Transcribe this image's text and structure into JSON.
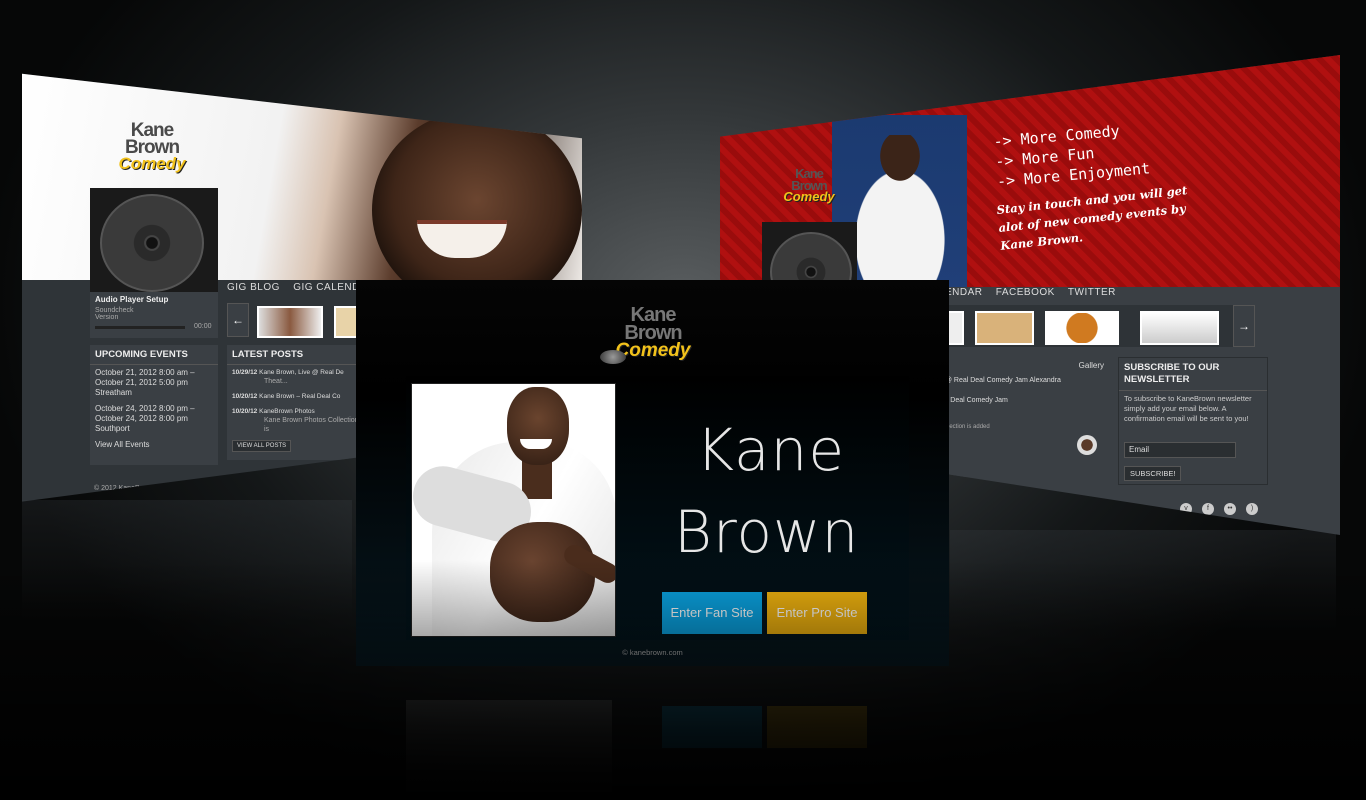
{
  "main": {
    "logo": {
      "line1": "Kane",
      "line2": "Brown",
      "line3": "Comedy"
    },
    "name_line1": "Kane",
    "name_line2": "Brown",
    "fan_button": "Enter Fan Site",
    "pro_button": "Enter Pro Site",
    "footer": "© kanebrown.com",
    "colors": {
      "fan": "#0aa4e3",
      "pro": "#f2b40f"
    }
  },
  "left_preview": {
    "nav": [
      "GIG BLOG",
      "GIG CALENDAR"
    ],
    "player": {
      "title": "Audio Player Setup",
      "track": "Soundcheck",
      "version": "Version",
      "time": "00:00"
    },
    "events_heading": "UPCOMING EVENTS",
    "events": [
      {
        "line1": "October 21, 2012 8:00 am –",
        "line2": "October 21, 2012 5:00 pm",
        "place": "Streatham"
      },
      {
        "line1": "October 24, 2012 8:00 pm –",
        "line2": "October 24, 2012 8:00 pm",
        "place": "Southport"
      }
    ],
    "view_all_events": "View All Events",
    "posts_heading": "LATEST POSTS",
    "posts": [
      {
        "date": "10/29/12",
        "title": "Kane Brown, Live @ Real De",
        "sub": "Theat..."
      },
      {
        "date": "10/20/12",
        "title": "Kane Brown – Real Deal Co",
        "sub": ""
      },
      {
        "date": "10/20/12",
        "title": "KaneBrown Photos",
        "sub": "Kane Brown Photos Collection is"
      }
    ],
    "view_all_posts": "VIEW ALL POSTS",
    "copyright": "© 2012 KaneBrown.com"
  },
  "right_preview": {
    "promo_lines": [
      {
        "arrow": "->",
        "text": "More Comedy"
      },
      {
        "arrow": "->",
        "text": "More Fun"
      },
      {
        "arrow": "->",
        "text": "More Enjoyment"
      }
    ],
    "promo_text": "Stay in touch and you will get alot of new comedy events by Kane Brown.",
    "nav": [
      "ENDAR",
      "FACEBOOK",
      "TWITTER"
    ],
    "gallery_label": "Gallery",
    "gallery_items": [
      "e @ Real Deal Comedy Jam Alexandra",
      "eal Deal Comedy Jam",
      "tos",
      "Collection is added"
    ],
    "subscribe_heading": "SUBSCRIBE TO OUR NEWSLETTER",
    "subscribe_text": "To subscribe to KaneBrown newsletter simply add your email below. A confirmation email will be sent to you!",
    "email_placeholder": "Email",
    "subscribe_button": "SUBSCRIBE!",
    "social_icons": [
      "vimeo-icon",
      "facebook-icon",
      "flickr-icon",
      "rss-icon"
    ]
  }
}
